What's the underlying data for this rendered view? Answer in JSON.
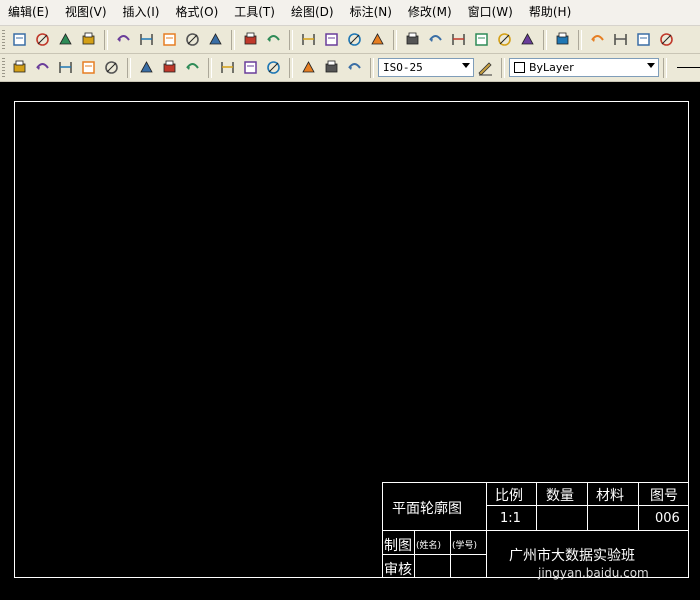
{
  "menu": [
    "编辑(E)",
    "视图(V)",
    "插入(I)",
    "格式(O)",
    "工具(T)",
    "绘图(D)",
    "标注(N)",
    "修改(M)",
    "窗口(W)",
    "帮助(H)"
  ],
  "toolbar": {
    "icons1": [
      "plot-icon",
      "plot-preview-icon",
      "publish-icon",
      "globe-icon",
      "cut-icon",
      "copy-icon",
      "paste-icon",
      "match-properties-icon",
      "block-editor-icon",
      "undo-icon",
      "redo-icon",
      "pan-icon",
      "zoom-realtime-icon",
      "zoom-window-icon",
      "zoom-previous-icon",
      "properties-icon",
      "design-center-icon",
      "tool-palettes-icon",
      "sheet-set-icon",
      "markup-icon",
      "calculator-icon",
      "help-icon",
      "orbit-icon",
      "orbit-free-icon",
      "orbit-continuous-icon",
      "3d-box-icon"
    ],
    "icons2": [
      "dim-ordinate-icon",
      "dim-radius-icon",
      "dim-jogged-icon",
      "dim-diameter-icon",
      "dim-angular-icon",
      "quick-dim-icon",
      "dim-baseline-icon",
      "dim-continue-icon",
      "quick-leader-icon",
      "tolerance-icon",
      "center-mark-icon",
      "dim-edit-icon",
      "dim-text-edit-icon",
      "dim-update-icon"
    ],
    "dim_style": "ISO-25",
    "layer_value": "ByLayer"
  },
  "title_block": {
    "title": "平面轮廓图",
    "scale_label": "比例",
    "qty_label": "数量",
    "material_label": "材料",
    "drawing_no_label": "图号",
    "scale_value": "1:1",
    "drawing_no_value": "006",
    "drawn_label": "制图",
    "name_placeholder": "(姓名)",
    "id_placeholder": "(学号)",
    "review_label": "审核",
    "school": "广州市大数据实验班"
  },
  "watermark": "jingyan.baidu.com"
}
